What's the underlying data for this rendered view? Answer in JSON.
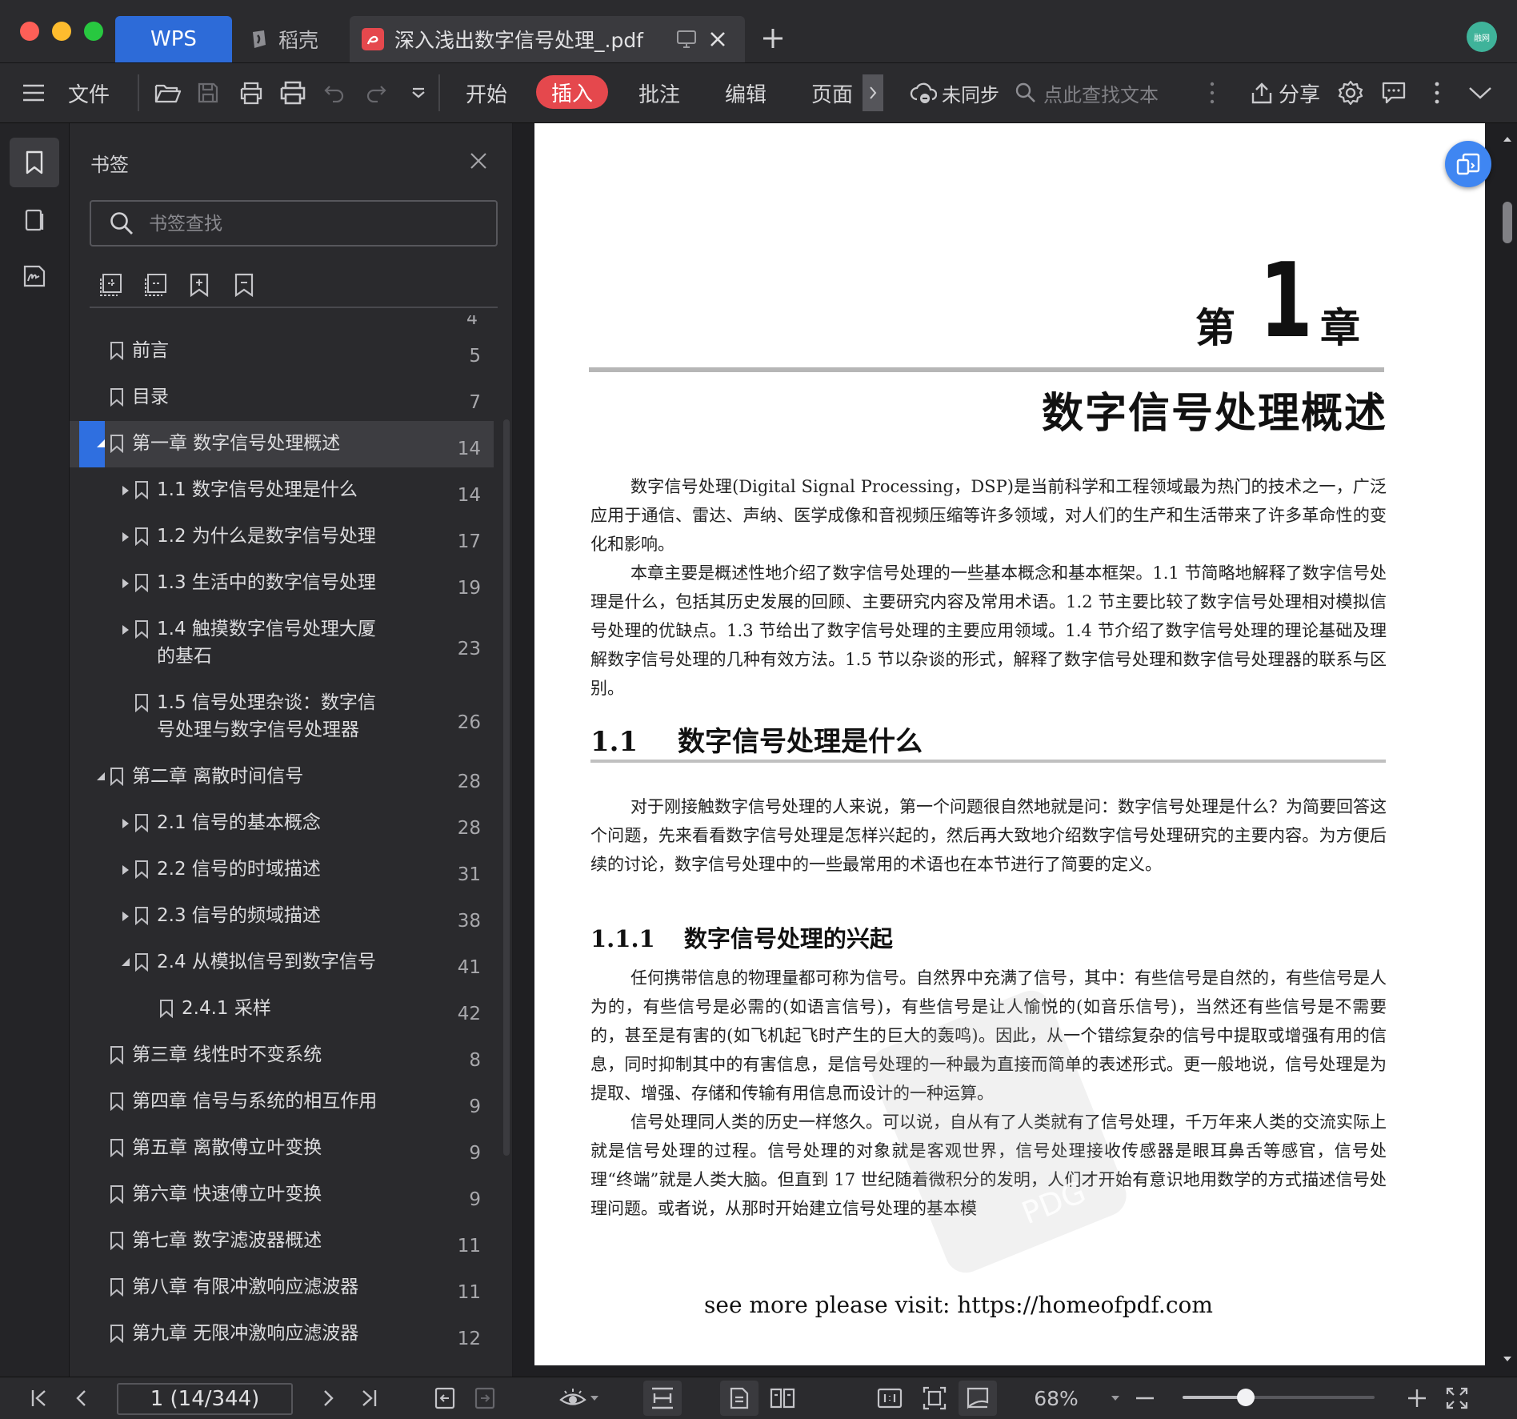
{
  "titlebar": {
    "tabs": [
      {
        "label": "WPS"
      },
      {
        "label": "稻壳"
      },
      {
        "label": "深入浅出数字信号处理_.pdf"
      }
    ],
    "avatar_text": "融网"
  },
  "toolbar": {
    "file_label": "文件",
    "menus": [
      "开始",
      "插入",
      "批注",
      "编辑",
      "页面"
    ],
    "sync_label": "未同步",
    "find_placeholder": "点此查找文本",
    "share_label": "分享"
  },
  "bookmark_panel": {
    "title": "书签",
    "search_placeholder": "书签查找",
    "partial_page": "4",
    "items": [
      {
        "label": "前言",
        "page": "5",
        "level": 0,
        "arrow": "none"
      },
      {
        "label": "目录",
        "page": "7",
        "level": 0,
        "arrow": "none"
      },
      {
        "label": "第一章 数字信号处理概述",
        "page": "14",
        "level": 0,
        "arrow": "down",
        "selected": true
      },
      {
        "label": "1.1 数字信号处理是什么",
        "page": "14",
        "level": 1,
        "arrow": "right"
      },
      {
        "label": "1.2 为什么是数字信号处理",
        "page": "17",
        "level": 1,
        "arrow": "right"
      },
      {
        "label": "1.3 生活中的数字信号处理",
        "page": "19",
        "level": 1,
        "arrow": "right"
      },
      {
        "label": "1.4 触摸数字信号处理大厦",
        "label2": "的基石",
        "page": "23",
        "level": 1,
        "arrow": "right"
      },
      {
        "label": "1.5 信号处理杂谈：数字信",
        "label2": "号处理与数字信号处理器",
        "page": "26",
        "level": 1,
        "arrow": "none"
      },
      {
        "label": "第二章 离散时间信号",
        "page": "28",
        "level": 0,
        "arrow": "down"
      },
      {
        "label": "2.1 信号的基本概念",
        "page": "28",
        "level": 1,
        "arrow": "right"
      },
      {
        "label": "2.2 信号的时域描述",
        "page": "31",
        "level": 1,
        "arrow": "right"
      },
      {
        "label": "2.3 信号的频域描述",
        "page": "38",
        "level": 1,
        "arrow": "right"
      },
      {
        "label": "2.4 从模拟信号到数字信号",
        "page": "41",
        "level": 1,
        "arrow": "down"
      },
      {
        "label": "2.4.1 采样",
        "page": "42",
        "level": 2,
        "arrow": "none"
      },
      {
        "label": "第三章 线性时不变系统",
        "page": "8",
        "level": 0,
        "arrow": "none"
      },
      {
        "label": "第四章 信号与系统的相互作用",
        "page": "9",
        "level": 0,
        "arrow": "none"
      },
      {
        "label": "第五章 离散傅立叶变换",
        "page": "9",
        "level": 0,
        "arrow": "none"
      },
      {
        "label": "第六章 快速傅立叶变换",
        "page": "9",
        "level": 0,
        "arrow": "none"
      },
      {
        "label": "第七章 数字滤波器概述",
        "page": "11",
        "level": 0,
        "arrow": "none"
      },
      {
        "label": "第八章 有限冲激响应滤波器",
        "page": "11",
        "level": 0,
        "arrow": "none"
      },
      {
        "label": "第九章 无限冲激响应滤波器",
        "page": "12",
        "level": 0,
        "arrow": "none"
      }
    ]
  },
  "document": {
    "chapter_prefix": "第",
    "chapter_number": "1",
    "chapter_suffix": "章",
    "chapter_title": "数字信号处理概述",
    "intro_paragraphs": [
      "数字信号处理(Digital Signal Processing，DSP)是当前科学和工程领域最为热门的技术之一，广泛应用于通信、雷达、声纳、医学成像和音视频压缩等许多领域，对人们的生产和生活带来了许多革命性的变化和影响。",
      "本章主要是概述性地介绍了数字信号处理的一些基本概念和基本框架。1.1 节简略地解释了数字信号处理是什么，包括其历史发展的回顾、主要研究内容及常用术语。1.2 节主要比较了数字信号处理相对模拟信号处理的优缺点。1.3 节给出了数字信号处理的主要应用领域。1.4 节介绍了数字信号处理的理论基础及理解数字信号处理的几种有效方法。1.5 节以杂谈的形式，解释了数字信号处理和数字信号处理器的联系与区别。"
    ],
    "section_number": "1.1",
    "section_title": "数字信号处理是什么",
    "section_paragraphs": [
      "对于刚接触数字信号处理的人来说，第一个问题很自然地就是问：数字信号处理是什么？为简要回答这个问题，先来看看数字信号处理是怎样兴起的，然后再大致地介绍数字信号处理研究的主要内容。为方便后续的讨论，数字信号处理中的一些最常用的术语也在本节进行了简要的定义。"
    ],
    "subsection_number": "1.1.1",
    "subsection_title": "数字信号处理的兴起",
    "subsection_paragraphs": [
      "任何携带信息的物理量都可称为信号。自然界中充满了信号，其中：有些信号是自然的，有些信号是人为的，有些信号是必需的(如语言信号)，有些信号是让人愉悦的(如音乐信号)，当然还有些信号是不需要的，甚至是有害的(如飞机起飞时产生的巨大的轰鸣)。因此，从一个错综复杂的信号中提取或增强有用的信息，同时抑制其中的有害信息，是信号处理的一种最为直接而简单的表述形式。更一般地说，信号处理是为提取、增强、存储和传输有用信息而设计的一种运算。",
      "信号处理同人类的历史一样悠久。可以说，自从有了人类就有了信号处理，千万年来人类的交流实际上就是信号处理的过程。信号处理的对象就是客观世界，信号处理接收传感器是眼耳鼻舌等感官，信号处理“终端”就是人类大脑。但直到 17 世纪随着微积分的发明，人们才开始有意识地用数学的方式描述信号处理问题。或者说，从那时开始建立信号处理的基本模"
    ],
    "watermark_text": "PDG",
    "footer": "see more please visit: https://homeofpdf.com"
  },
  "statusbar": {
    "page_value": "1 (14/344)",
    "zoom_label": "68%",
    "zoom_fraction": 0.33
  },
  "colors": {
    "accent_blue": "#2d6bd8",
    "insert_red": "#e5484d",
    "selection_bar": "#2f6fe0",
    "float_button": "#3f86f2"
  }
}
